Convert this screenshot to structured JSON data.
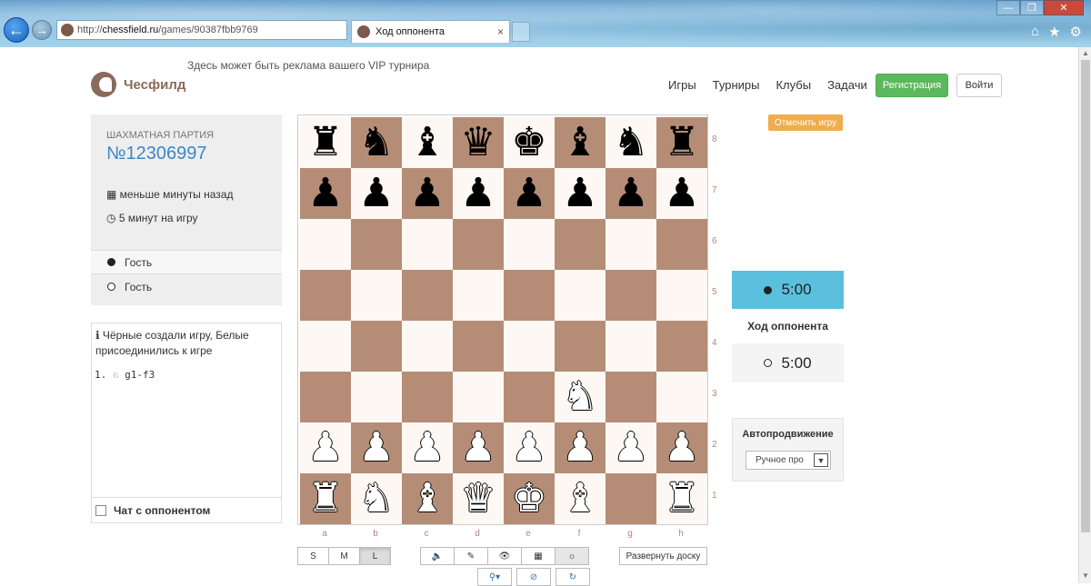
{
  "browser": {
    "url_prefix": "http://",
    "url_host": "chessfield.ru",
    "url_path": "/games/90387fbb9769",
    "tab_title": "Ход оппонента",
    "tab_close": "×",
    "back_glyph": "←",
    "forward_glyph": "→",
    "addr_tools": [
      "⚲▾",
      "⊘",
      "↻"
    ],
    "window_controls": [
      "—",
      "❐",
      "✕"
    ],
    "right_icons": [
      "⌂",
      "★",
      "⚙"
    ]
  },
  "site": {
    "brand": "Чесфилд",
    "ad_text": "Здесь может быть реклама вашего VIP турнира",
    "nav": [
      "Игры",
      "Турниры",
      "Клубы",
      "Задачи"
    ],
    "register": "Регистрация",
    "login": "Войти"
  },
  "game": {
    "label": "Шахматная партия",
    "number": "№12306997",
    "created": "меньше минуты назад",
    "created_icon": "calendar-icon",
    "time_control": "5 минут на игру",
    "time_icon": "clock-icon",
    "players": [
      {
        "color": "black",
        "name": "Гость"
      },
      {
        "color": "white",
        "name": "Гость"
      }
    ]
  },
  "moves_panel": {
    "note": "Чёрные создали игру, Белые присоединились к игре",
    "note_icon": "info-icon",
    "move_list": "1. ♘ g1-f3",
    "chat_label": "Чат с оппонентом"
  },
  "board": {
    "files": [
      "a",
      "b",
      "c",
      "d",
      "e",
      "f",
      "g",
      "h"
    ],
    "ranks": [
      "8",
      "7",
      "6",
      "5",
      "4",
      "3",
      "2",
      "1"
    ],
    "position": [
      [
        "r",
        "n",
        "b",
        "q",
        "k",
        "b",
        "n",
        "r"
      ],
      [
        "p",
        "p",
        "p",
        "p",
        "p",
        "p",
        "p",
        "p"
      ],
      [
        "",
        "",
        "",
        "",
        "",
        "",
        "",
        ""
      ],
      [
        "",
        "",
        "",
        "",
        "",
        "",
        "",
        ""
      ],
      [
        "",
        "",
        "",
        "",
        "",
        "",
        "",
        ""
      ],
      [
        "",
        "",
        "",
        "",
        "",
        "N",
        "",
        ""
      ],
      [
        "P",
        "P",
        "P",
        "P",
        "P",
        "P",
        "P",
        "P"
      ],
      [
        "R",
        "N",
        "B",
        "Q",
        "K",
        "B",
        "",
        "R"
      ]
    ],
    "light_color": "#fdf8f4",
    "dark_color": "#b58d76"
  },
  "controls": {
    "sizes": [
      "S",
      "M",
      "L"
    ],
    "active_size": "L",
    "tools": [
      "🔈",
      "✎",
      "👁",
      "▦",
      "☼"
    ],
    "tool_names": [
      "sound-icon",
      "magic-wand-icon",
      "eye-icon",
      "grid-icon",
      "settings-sun-icon"
    ],
    "expand": "Развернуть доску"
  },
  "right": {
    "cancel": "Отменить игру",
    "clock_top": "5:00",
    "clock_status": "Ход оппонента",
    "clock_bottom": "5:00",
    "autopromo_title": "Автопродвижение",
    "autopromo_value": "Ручное про",
    "accent": "#5bc0de",
    "cancel_color": "#f0ad4e",
    "register_color": "#5cb85c"
  }
}
